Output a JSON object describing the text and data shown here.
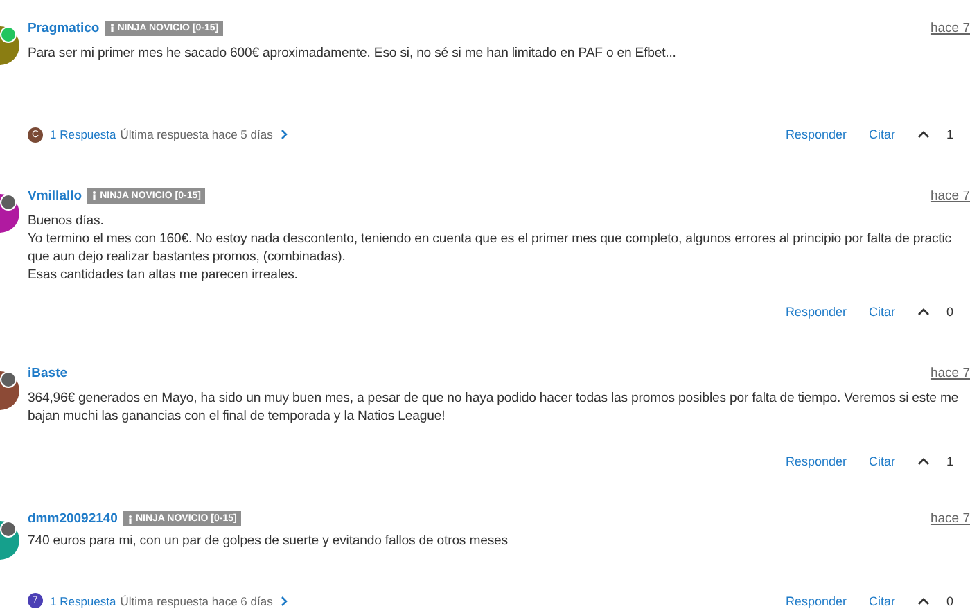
{
  "posts": [
    {
      "author": {
        "name": "Pragmatico",
        "color": "#8a7d12",
        "online": true
      },
      "badge": "NINJA NOVICIO [0-15]",
      "time": "hace 7",
      "body": "Para ser mi primer mes he sacado 600€ aproximadamente. Eso si, no sé si me han limitado en PAF o en Efbet...",
      "replies": {
        "avatar_letter": "C",
        "color": "#7a4a35",
        "count": "1 Respuesta",
        "last": "Última respuesta hace 5 días"
      },
      "actions": [
        "Responder",
        "Citar"
      ],
      "votes": "1"
    },
    {
      "author": {
        "name": "Vmillallo",
        "color": "#b01aa0",
        "online": false
      },
      "badge": "NINJA NOVICIO [0-15]",
      "time": "hace 7",
      "body": "Buenos días.\nYo termino el mes con 160€. No estoy nada descontento, teniendo en cuenta que es el primer mes que completo, algunos errores al principio por falta de practic\nque aun dejo realizar bastantes promos, (combinadas).\nEsas cantidades tan altas me parecen irreales.",
      "actions": [
        "Responder",
        "Citar"
      ],
      "votes": "0"
    },
    {
      "author": {
        "name": "iBaste",
        "color": "#8c4a36",
        "online": false
      },
      "time": "hace 7",
      "body": "364,96€ generados en Mayo, ha sido un muy buen mes, a pesar de que no haya podido hacer todas las promos posibles por falta de tiempo. Veremos si este me\nbajan muchi las ganancias con el final de temporada y la Natios League!",
      "actions": [
        "Responder",
        "Citar"
      ],
      "votes": "1"
    },
    {
      "author": {
        "name": "dmm20092140",
        "color": "#15a08c",
        "online": false
      },
      "badge": "NINJA NOVICIO [0-15]",
      "time": "hace 7",
      "body": "740 euros para mi, con un par de golpes de suerte y evitando fallos de otros meses",
      "replies": {
        "avatar_letter": "7",
        "color": "#4b3fb5",
        "count": "1 Respuesta",
        "last": "Última respuesta hace 6 días"
      },
      "actions": [
        "Responder",
        "Citar"
      ],
      "votes": "0"
    }
  ]
}
